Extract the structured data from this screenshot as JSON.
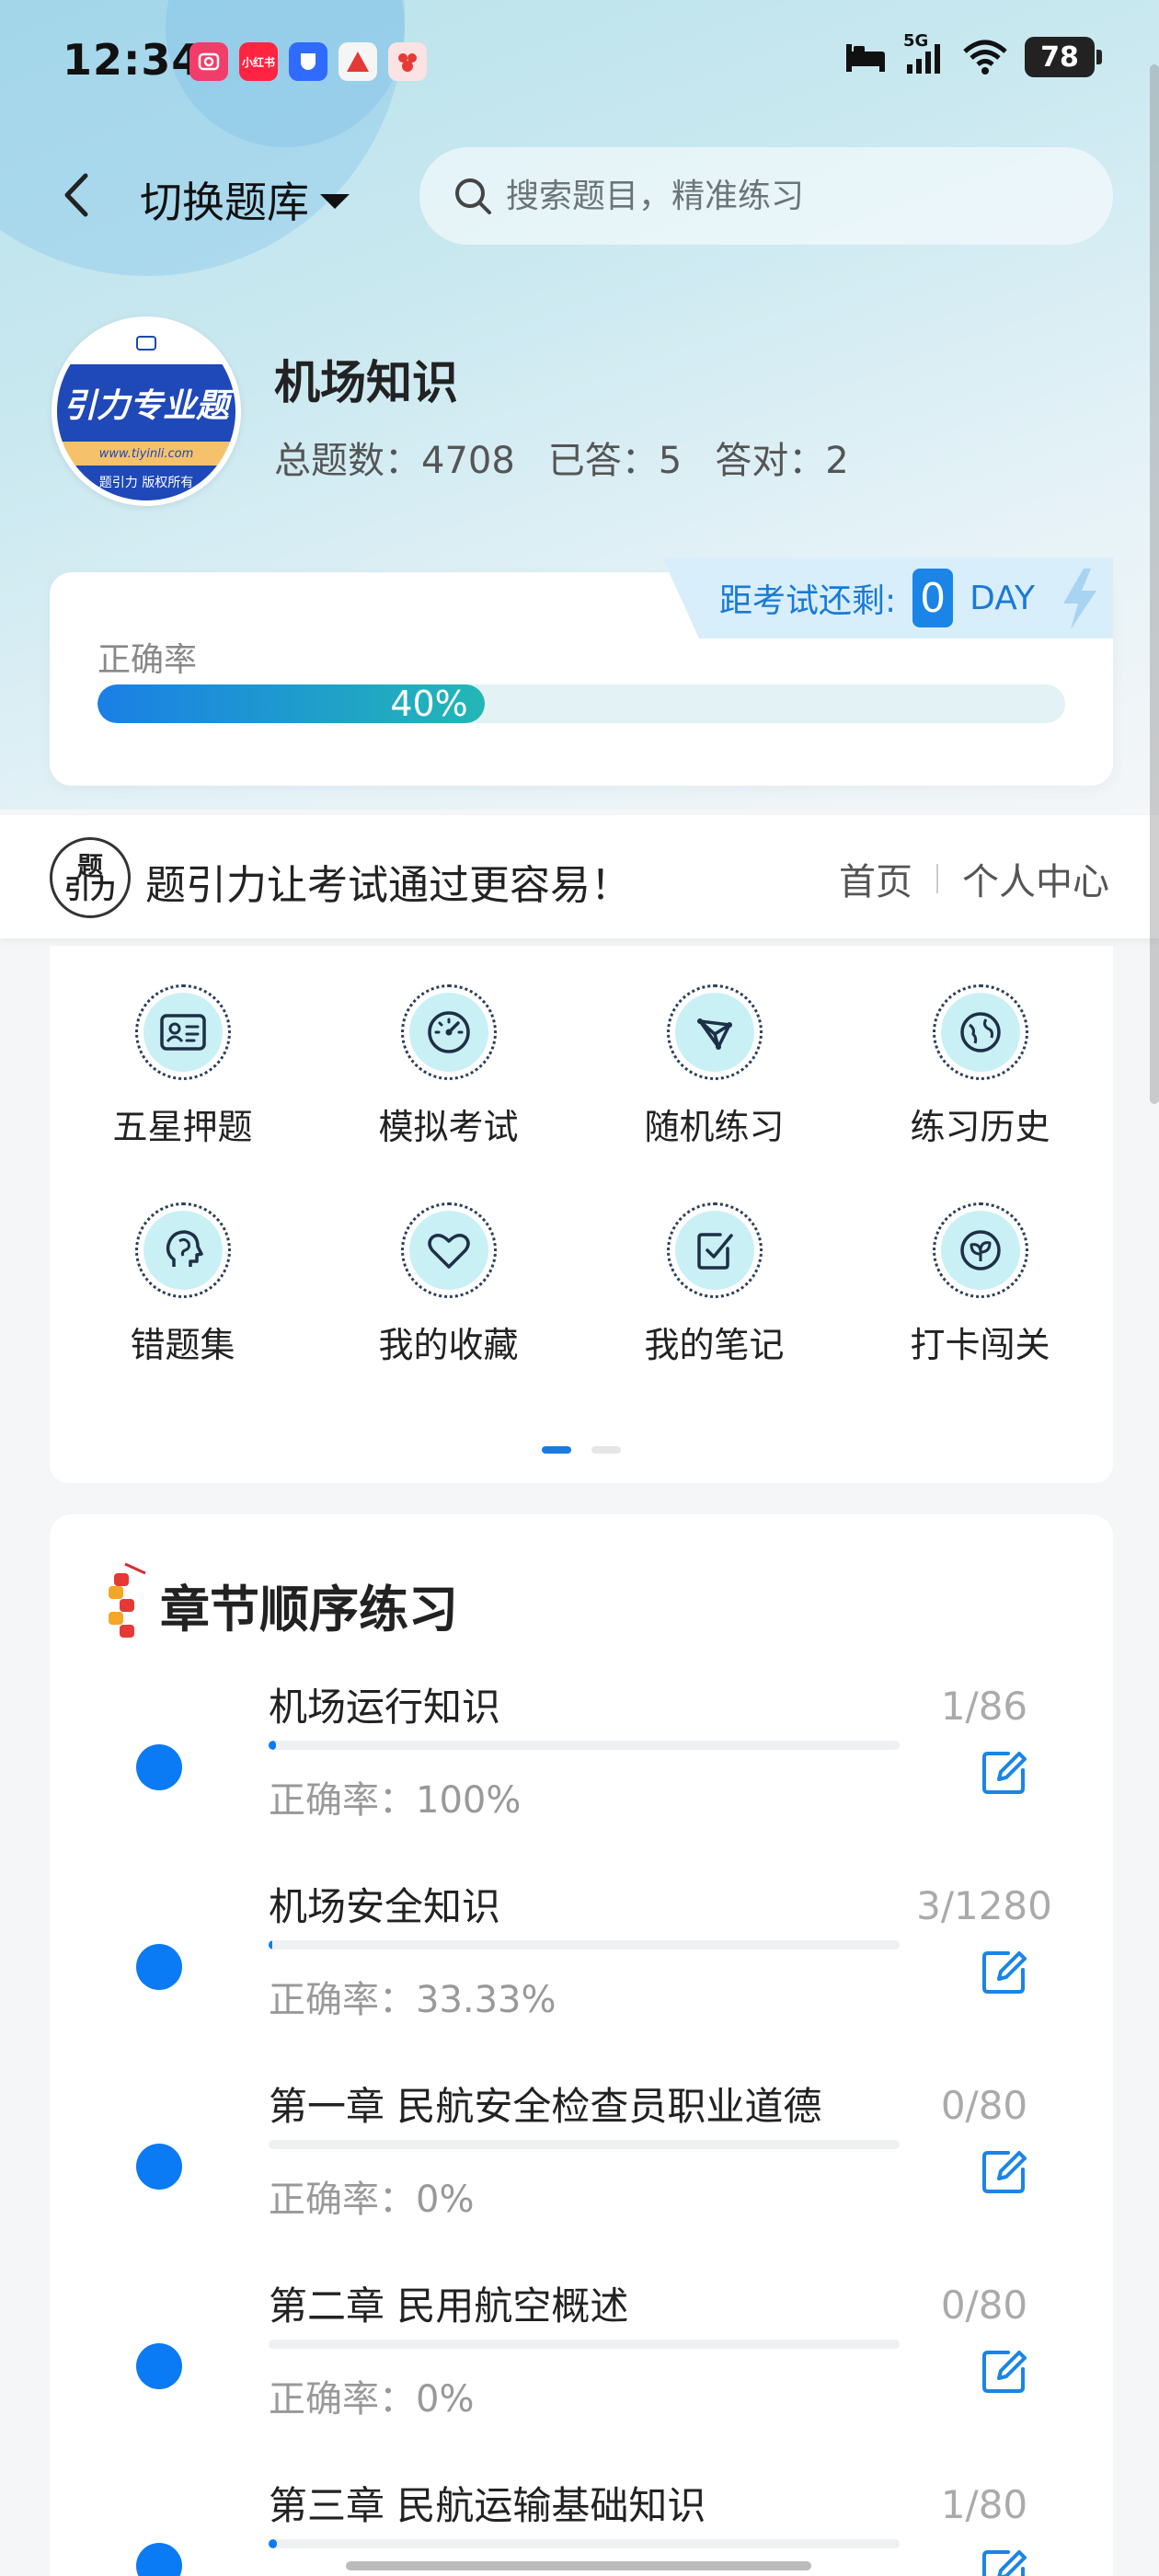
{
  "status_bar": {
    "time": "12:34",
    "battery": "78",
    "network": "5G",
    "notification_icons": [
      "camera-app-icon",
      "xiaohongshu-icon",
      "security-app-icon",
      "alert-app-icon",
      "store-app-icon"
    ],
    "notification_labels": [
      "",
      "小红书",
      "",
      "",
      ""
    ]
  },
  "header": {
    "switch_label": "切换题库",
    "search_placeholder": "搜索题目，精准练习"
  },
  "bank": {
    "title": "机场知识",
    "stats": {
      "total": "总题数：4708",
      "answered": "已答：5",
      "correct": "答对：2"
    },
    "logo": {
      "band_text": "引力专业题",
      "url": "www.tiyinli.com",
      "copyright": "题引力 版权所有"
    }
  },
  "accuracy": {
    "label": "正确率",
    "value": "40%",
    "fraction": 0.4,
    "countdown_label": "距考试还剩:",
    "countdown_value": "0",
    "countdown_unit": "DAY"
  },
  "slogan": {
    "logo_line1": "题",
    "logo_line2": "引力",
    "text": "题引力让考试通过更容易！",
    "links": [
      "首页",
      "个人中心"
    ]
  },
  "functions": [
    {
      "label": "五星押题",
      "icon": "id-card-icon"
    },
    {
      "label": "模拟考试",
      "icon": "speedometer-icon"
    },
    {
      "label": "随机练习",
      "icon": "random-network-icon"
    },
    {
      "label": "练习历史",
      "icon": "globe-history-icon"
    },
    {
      "label": "错题集",
      "icon": "head-brain-icon"
    },
    {
      "label": "我的收藏",
      "icon": "heart-icon"
    },
    {
      "label": "我的笔记",
      "icon": "checked-note-icon"
    },
    {
      "label": "打卡闯关",
      "icon": "leaf-badge-icon"
    }
  ],
  "pager": {
    "pages": 2,
    "active": 0
  },
  "chapters": {
    "title": "章节顺序练习",
    "rows": [
      {
        "name": "机场运行知识",
        "accuracy": "正确率：100%",
        "count": "1/86",
        "progress": 0.0116
      },
      {
        "name": "机场安全知识",
        "accuracy": "正确率：33.33%",
        "count": "3/1280",
        "progress": 0.0023
      },
      {
        "name": "第一章 民航安全检查员职业道德",
        "accuracy": "正确率：0%",
        "count": "0/80",
        "progress": 0
      },
      {
        "name": "第二章 民用航空概述",
        "accuracy": "正确率：0%",
        "count": "0/80",
        "progress": 0
      },
      {
        "name": "第三章 民航运输基础知识",
        "accuracy": "",
        "count": "1/80",
        "progress": 0.0125
      }
    ]
  },
  "colors": {
    "accent": "#0b7af5",
    "accuracy_gradient_start": "#1a7fe6",
    "accuracy_gradient_end": "#23b7b6",
    "icon_fill": "#c9f0f5"
  }
}
